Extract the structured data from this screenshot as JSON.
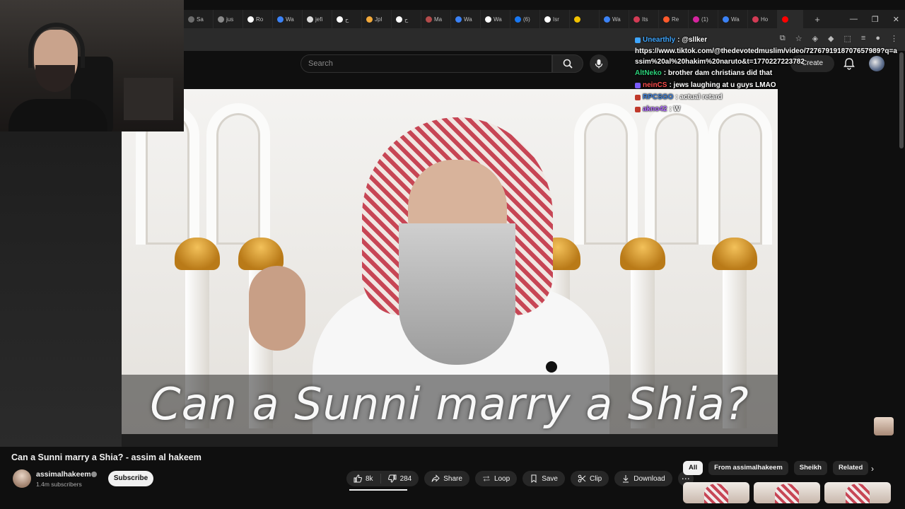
{
  "browser": {
    "tabs": [
      {
        "label": "Sa",
        "color": "#6d6d6d"
      },
      {
        "label": "jus",
        "color": "#8a8a8a"
      },
      {
        "label": "Ro",
        "color": "#ffffff"
      },
      {
        "label": "Wa",
        "color": "#3b82f6"
      },
      {
        "label": "jefi",
        "color": "#dddddd"
      },
      {
        "label": "ح",
        "color": "#ffffff"
      },
      {
        "label": "Jpl",
        "color": "#f2a93b"
      },
      {
        "label": "ح",
        "color": "#ffffff"
      },
      {
        "label": "Ma",
        "color": "#b34b4b"
      },
      {
        "label": "Wa",
        "color": "#3b82f6"
      },
      {
        "label": "Wa",
        "color": "#ffffff"
      },
      {
        "label": "(6)",
        "color": "#1877f2"
      },
      {
        "label": "Isr",
        "color": "#ffffff"
      },
      {
        "label": "",
        "color": "#f2c200"
      },
      {
        "label": "Wa",
        "color": "#3b82f6"
      },
      {
        "label": "Its",
        "color": "#d33b55"
      },
      {
        "label": "Re",
        "color": "#ff5a2c"
      },
      {
        "label": "(1)",
        "color": "#d6249f"
      },
      {
        "label": "Wa",
        "color": "#3b82f6"
      },
      {
        "label": "Ho",
        "color": "#d33b55"
      },
      {
        "label": "",
        "color": "#ff0000"
      }
    ],
    "new_tab": "+",
    "window_controls": [
      "—",
      "❐",
      "✕"
    ]
  },
  "youtube": {
    "search_placeholder": "Search",
    "create_label": "Create"
  },
  "chat": [
    {
      "user": "Unearthly",
      "user_color": "#3ea6ff",
      "message": ": @sllker",
      "msg_color": "#ffffff",
      "badge_color": "#3ea6ff"
    },
    {
      "url": "https://www.tiktok.com/@thedevotedmuslim/video/7276791918707657989?q=assim%20al%20hakim%20naruto&t=1770227223782"
    },
    {
      "user": "AltNeko",
      "user_color": "#2bd27a",
      "message": ": brother dam christians did that",
      "msg_color": "#ffffff",
      "badge_color": ""
    },
    {
      "user": "neinCS",
      "user_color": "#ff4d4d",
      "message": ": jews laughing at u guys LMAO",
      "msg_color": "#ffffff",
      "badge_color": "#7a5cff"
    },
    {
      "user": "RPCSGO",
      "user_color": "#3a7bd5",
      "message": ": actual retard",
      "msg_color": "#ffffff",
      "badge_color": "#c0392b"
    },
    {
      "user": "akno42",
      "user_color": "#b26bff",
      "message": ": W",
      "msg_color": "#ffffff",
      "badge_color": "#c0392b"
    }
  ],
  "video": {
    "caption": "Can a Sunni marry a Shia?",
    "title": "Can a Sunni marry a Shia? - assim al hakeem"
  },
  "channel": {
    "name": "assimalhakeem",
    "subscribers": "1.4m subscribers",
    "subscribe_label": "Subscribe"
  },
  "actions": {
    "likes": "8k",
    "dislikes": "284",
    "share": "Share",
    "loop": "Loop",
    "save": "Save",
    "clip": "Clip",
    "download": "Download",
    "more": "⋯"
  },
  "chips": [
    "All",
    "From assimalhakeem",
    "Sheikh",
    "Related"
  ]
}
